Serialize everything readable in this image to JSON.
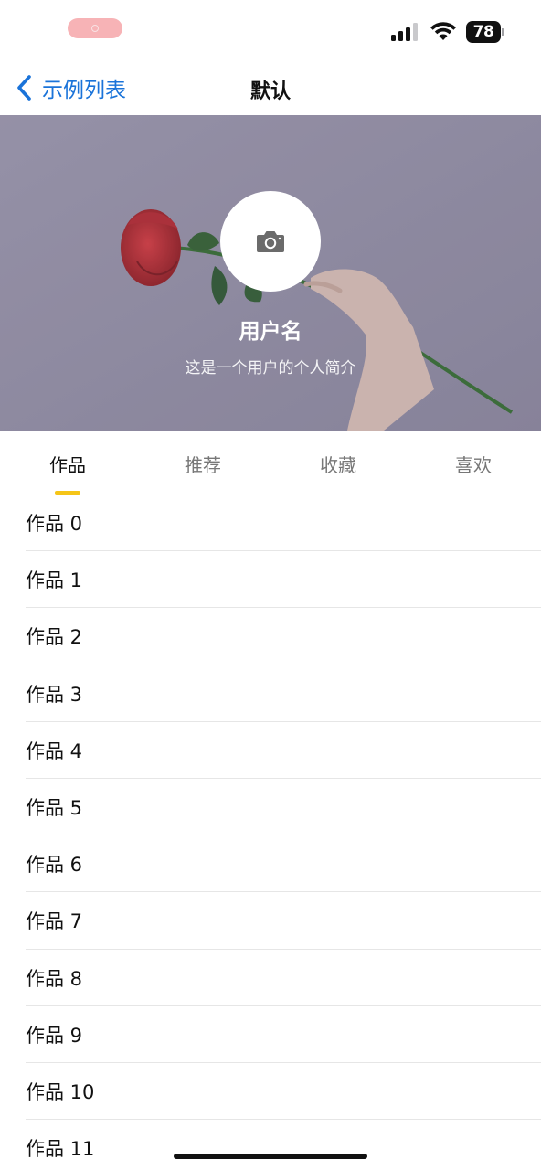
{
  "status_bar": {
    "battery": "78"
  },
  "nav": {
    "back_label": "示例列表",
    "title": "默认"
  },
  "header": {
    "username": "用户名",
    "bio": "这是一个用户的个人简介"
  },
  "tabs": [
    {
      "label": "作品",
      "active": true
    },
    {
      "label": "推荐",
      "active": false
    },
    {
      "label": "收藏",
      "active": false
    },
    {
      "label": "喜欢",
      "active": false
    }
  ],
  "list": {
    "items": [
      "作品 0",
      "作品 1",
      "作品 2",
      "作品 3",
      "作品 4",
      "作品 5",
      "作品 6",
      "作品 7",
      "作品 8",
      "作品 9",
      "作品 10",
      "作品 11"
    ]
  },
  "colors": {
    "accent_link": "#1a73d9",
    "tab_indicator": "#f5c518"
  }
}
